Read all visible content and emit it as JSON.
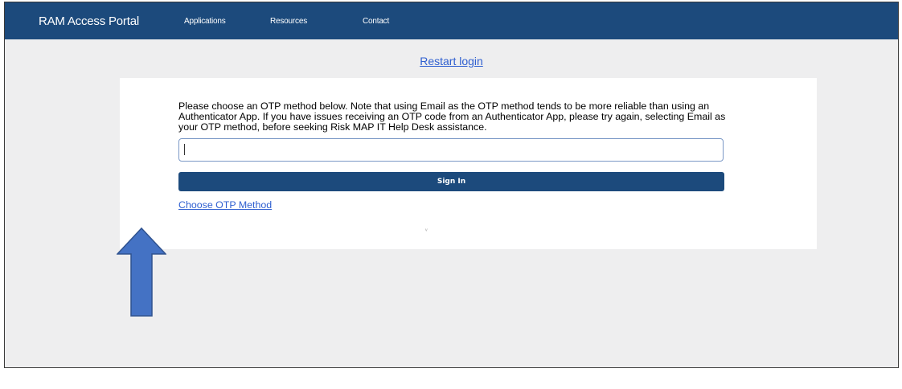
{
  "header": {
    "brand": "RAM Access Portal",
    "nav": [
      "Applications",
      "Resources",
      "Contact"
    ]
  },
  "restart_link": "Restart login",
  "login": {
    "notice": "Please choose an OTP method below. Note that using Email as the OTP method tends to be more reliable than using an Authenticator App. If you have issues receiving an OTP code from an Authenticator App, please try again, selecting Email as your OTP method, before seeking Risk MAP IT Help Desk assistance.",
    "otp_value": "",
    "sign_in_label": "Sign In",
    "choose_method_label": "Choose OTP Method",
    "spinner_glyph": "ᵥ"
  },
  "colors": {
    "header_bg": "#1c4a7c",
    "link": "#2f5fd0",
    "page_bg": "#eeeeef",
    "arrow_fill": "#4472c4",
    "arrow_stroke": "#2f528f"
  },
  "annotation": {
    "icon": "arrow-up-icon"
  }
}
